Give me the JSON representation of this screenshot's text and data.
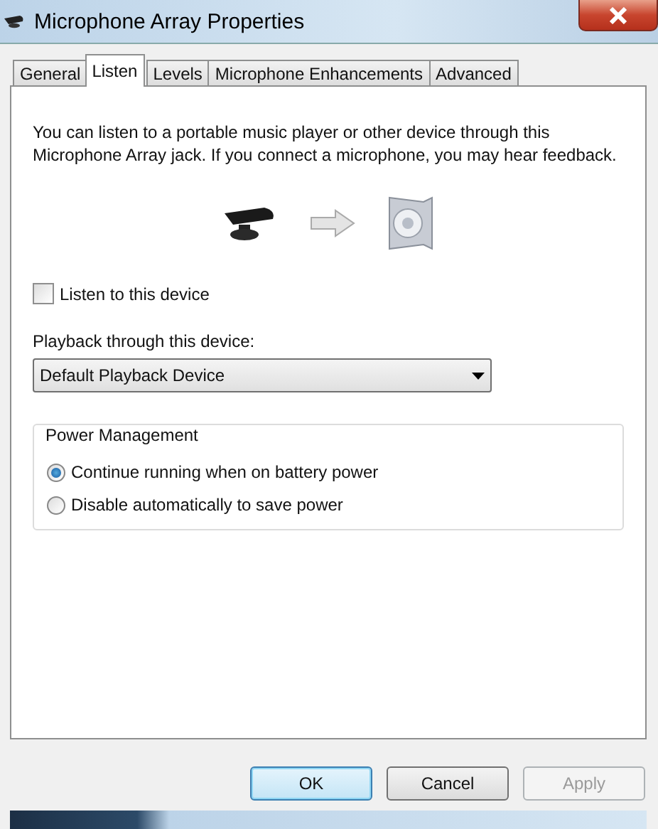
{
  "window": {
    "title": "Microphone Array Properties"
  },
  "tabs": [
    {
      "label": "General",
      "selected": false
    },
    {
      "label": "Listen",
      "selected": true
    },
    {
      "label": "Levels",
      "selected": false
    },
    {
      "label": "Microphone Enhancements",
      "selected": false
    },
    {
      "label": "Advanced",
      "selected": false
    }
  ],
  "description": "You can listen to a portable music player or other device through this Microphone Array jack.  If you connect a microphone, you may hear feedback.",
  "listen_checkbox": {
    "label": "Listen to this device",
    "checked": false
  },
  "playback": {
    "label": "Playback through this device:",
    "value": "Default Playback Device"
  },
  "power_management": {
    "title": "Power Management",
    "options": [
      {
        "label": "Continue running when on battery power",
        "selected": true
      },
      {
        "label": "Disable automatically to save power",
        "selected": false
      }
    ]
  },
  "buttons": [
    {
      "label": "OK",
      "default": true,
      "disabled": false
    },
    {
      "label": "Cancel",
      "default": false,
      "disabled": false
    },
    {
      "label": "Apply",
      "default": false,
      "disabled": true
    }
  ]
}
